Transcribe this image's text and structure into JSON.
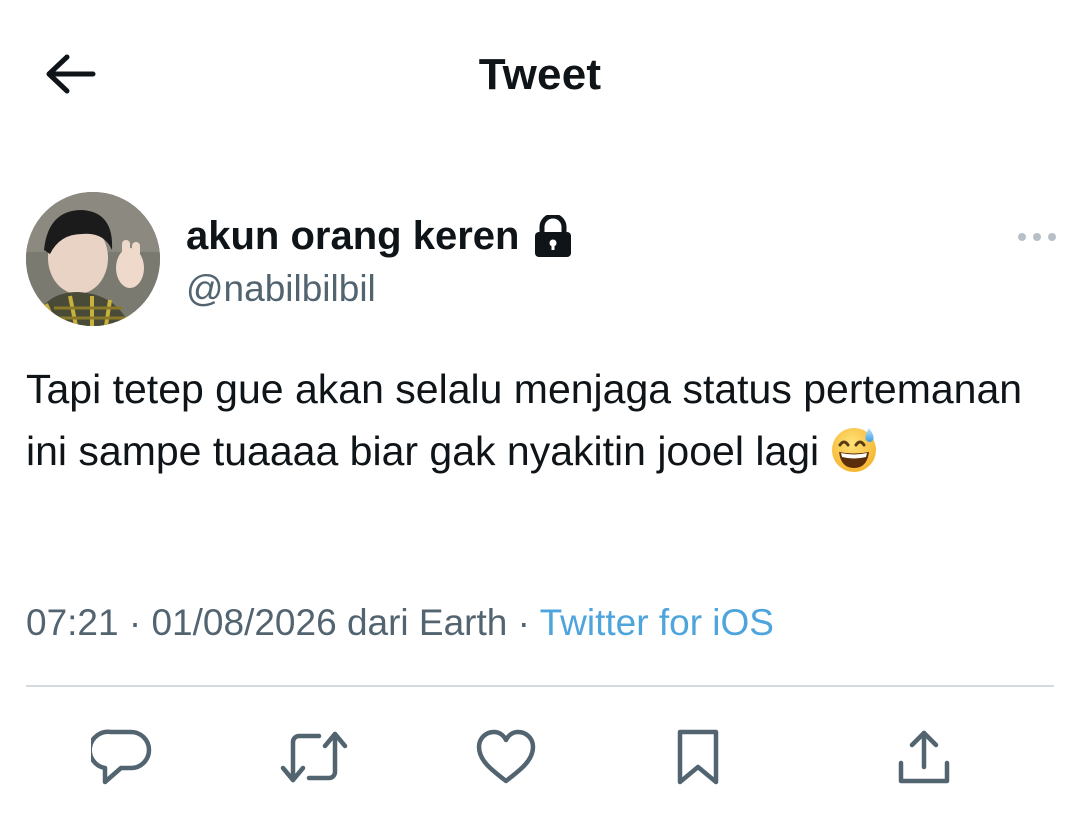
{
  "header": {
    "title": "Tweet",
    "back_icon": "arrow-left-icon"
  },
  "tweet": {
    "author": {
      "display_name": "akun orang keren",
      "handle": "@nabilbilbil",
      "protected_icon": "lock-icon"
    },
    "text": "Tapi tetep gue akan selalu menjaga status pertemanan ini sampe tuaaaa biar gak nyakitin jooel lagi",
    "emoji": "grinning-face-with-sweat-emoji",
    "time": "07:21",
    "separator": "·",
    "date": "01/08/2026",
    "location": "dari Earth",
    "source": "Twitter for iOS"
  },
  "actions": [
    {
      "icon": "reply-icon"
    },
    {
      "icon": "retweet-icon"
    },
    {
      "icon": "like-icon"
    },
    {
      "icon": "bookmark-icon"
    },
    {
      "icon": "share-icon"
    }
  ],
  "colors": {
    "text": "#0f1419",
    "secondary": "#536471",
    "link": "#4ea4dc",
    "divider": "#d4dbe0",
    "icon": "#536471"
  }
}
